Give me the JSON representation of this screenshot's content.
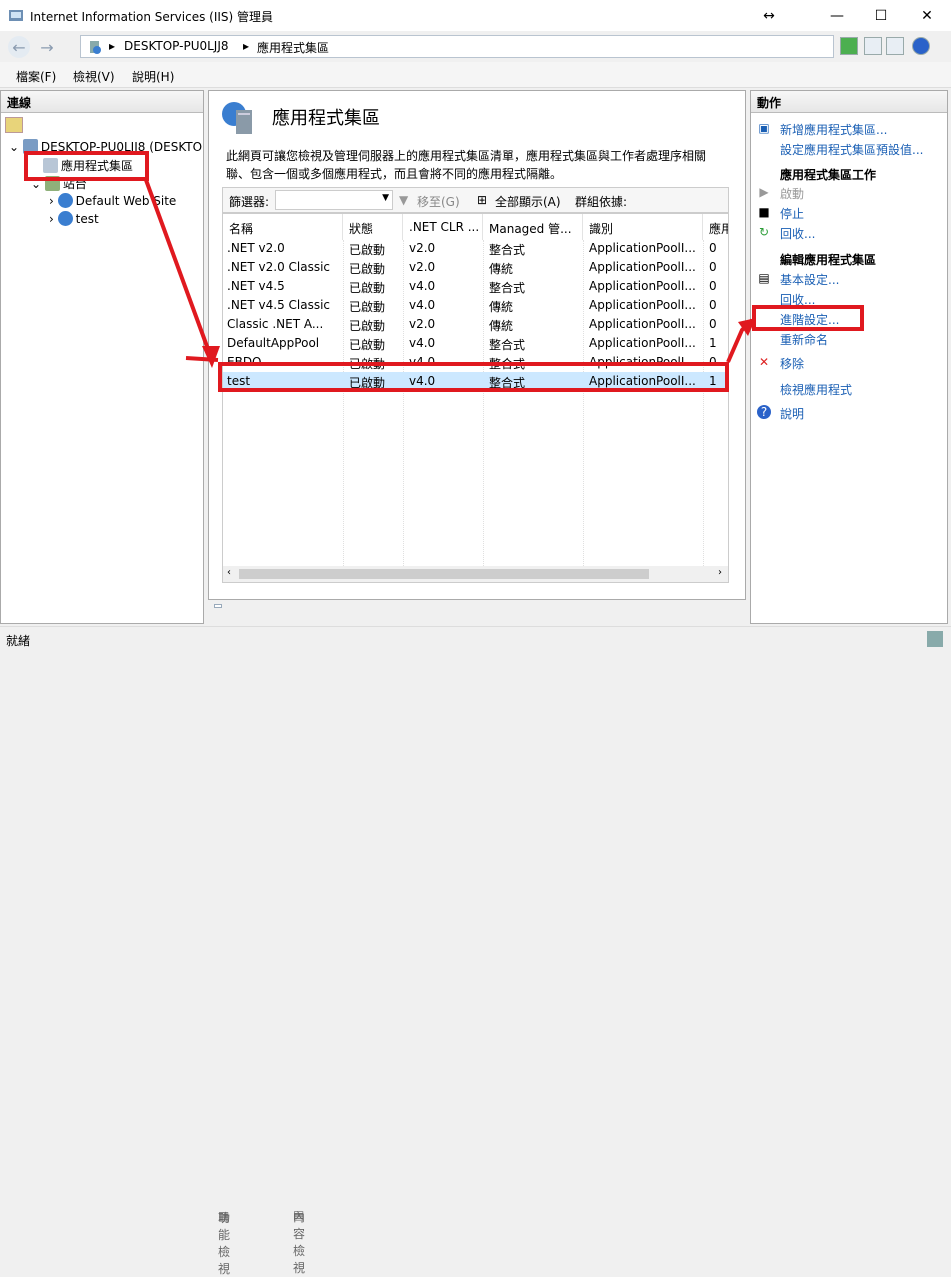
{
  "window": {
    "title": "Internet Information Services (IIS) 管理員"
  },
  "address": {
    "crumbs": [
      "DESKTOP-PU0LJJ8",
      "應用程式集區"
    ]
  },
  "menu": {
    "file": "檔案(F)",
    "view": "檢視(V)",
    "help": "說明(H)"
  },
  "connections": {
    "title": "連線",
    "server": "DESKTOP-PU0LJJ8 (DESKTO",
    "app_pools": "應用程式集區",
    "sites": "站台",
    "site1": "Default Web Site",
    "site2": "test"
  },
  "main": {
    "title": "應用程式集區",
    "description": "此網頁可讓您檢視及管理伺服器上的應用程式集區清單，應用程式集區與工作者處理序相關聯、包含一個或多個應用程式，而且會將不同的應用程式隔離。",
    "filter_label": "篩選器:",
    "goto_label": "移至(G)",
    "show_all_label": "全部顯示(A)",
    "group_by_label": "群組依據:",
    "columns": [
      "名稱",
      "狀態",
      ".NET CLR ...",
      "Managed 管...",
      "識別",
      "應用"
    ],
    "rows": [
      {
        "name": ".NET v2.0",
        "status": "已啟動",
        "clr": "v2.0",
        "pipeline": "整合式",
        "identity": "ApplicationPoolI...",
        "apps": "0"
      },
      {
        "name": ".NET v2.0 Classic",
        "status": "已啟動",
        "clr": "v2.0",
        "pipeline": "傳統",
        "identity": "ApplicationPoolI...",
        "apps": "0"
      },
      {
        "name": ".NET v4.5",
        "status": "已啟動",
        "clr": "v4.0",
        "pipeline": "整合式",
        "identity": "ApplicationPoolI...",
        "apps": "0"
      },
      {
        "name": ".NET v4.5 Classic",
        "status": "已啟動",
        "clr": "v4.0",
        "pipeline": "傳統",
        "identity": "ApplicationPoolI...",
        "apps": "0"
      },
      {
        "name": "Classic .NET A...",
        "status": "已啟動",
        "clr": "v2.0",
        "pipeline": "傳統",
        "identity": "ApplicationPoolI...",
        "apps": "0"
      },
      {
        "name": "DefaultAppPool",
        "status": "已啟動",
        "clr": "v4.0",
        "pipeline": "整合式",
        "identity": "ApplicationPoolI...",
        "apps": "1"
      },
      {
        "name": "EBDO",
        "status": "已啟動",
        "clr": "v4.0",
        "pipeline": "整合式",
        "identity": "ApplicationPoolI...",
        "apps": "0"
      },
      {
        "name": "test",
        "status": "已啟動",
        "clr": "v4.0",
        "pipeline": "整合式",
        "identity": "ApplicationPoolI...",
        "apps": "1"
      }
    ],
    "tab_features": "功能檢視",
    "tab_content": "內容檢視"
  },
  "actions": {
    "title": "動作",
    "add_pool": "新增應用程式集區...",
    "set_defaults": "設定應用程式集區預設值...",
    "tasks_head": "應用程式集區工作",
    "start": "啟動",
    "stop": "停止",
    "recycle": "回收...",
    "edit_head": "編輯應用程式集區",
    "basic": "基本設定...",
    "recycle2": "回收...",
    "advanced": "進階設定...",
    "rename": "重新命名",
    "remove": "移除",
    "view_apps": "檢視應用程式",
    "help": "說明"
  },
  "status": {
    "text": "就緒"
  },
  "colors": {
    "annotation": "#e0191f",
    "selection": "#cce8ff",
    "link": "#1a5fb4"
  }
}
